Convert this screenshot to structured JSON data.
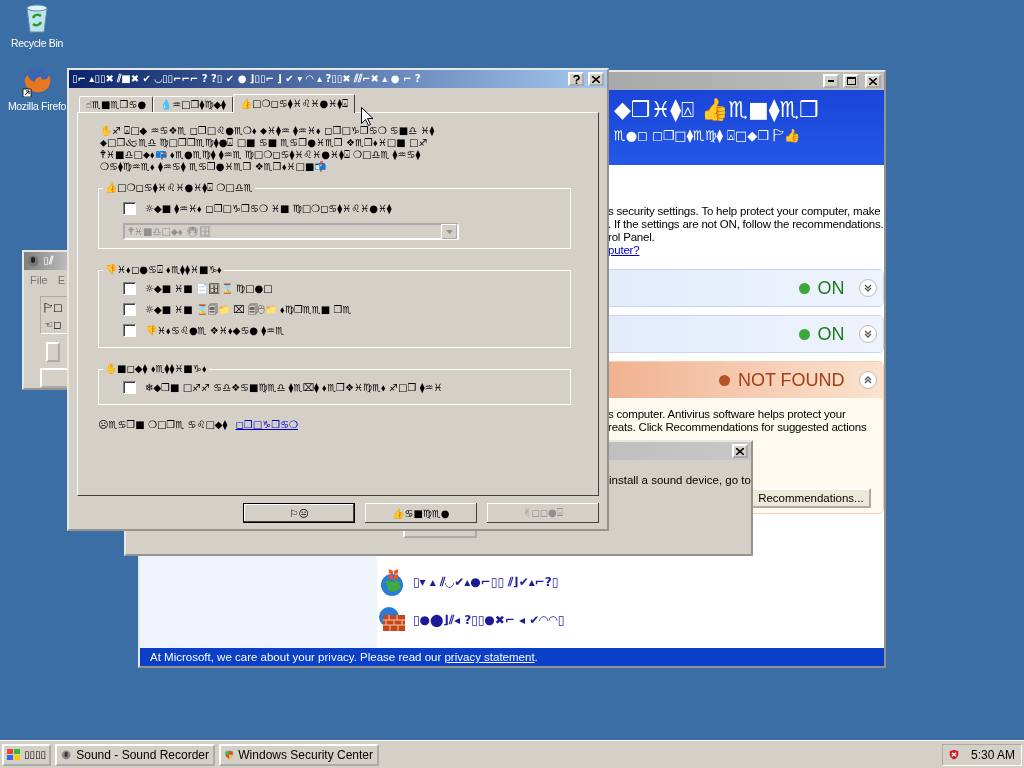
{
  "desktop_icons": [
    {
      "kind": "recycle",
      "label": "Recycle Bin"
    },
    {
      "kind": "browser",
      "label": "Mozilla Firefo"
    }
  ],
  "sound_recorder": {
    "title": "▯⫽",
    "menu": [
      "File",
      "E"
    ],
    "rows": [
      "🏱□",
      "☜◻"
    ]
  },
  "security_center": {
    "header_title": "◆❒♓⧫⍓ 👍♏■⧫♏❒",
    "header_subtitle": "♏●◻ ◻❒□⧫♏♍⧫ ⍓□◆❒ 🏱👍",
    "intro_lines": [
      "s security settings. To help protect your computer, make",
      ". If the settings are not ON, follow the recommendations.",
      "rol Panel."
    ],
    "intro_link": "puter?",
    "sections": [
      {
        "status": "ON",
        "color": "#3aa83a",
        "expanded": false
      },
      {
        "status": "ON",
        "color": "#3aa83a",
        "expanded": false
      },
      {
        "status": "NOT FOUND",
        "color": "#b5542c",
        "expanded": true,
        "body_lines": [
          "s computer. Antivirus software helps protect your",
          "reats. Click Recommendations for suggested actions"
        ],
        "button": "Recommendations..."
      }
    ],
    "links": [
      {
        "kind": "globe",
        "label": "▯▾ ▴ ⫽◡✔▴●⌐▯▯ ⫽⌋✔▴⌐?▯"
      },
      {
        "kind": "firewall",
        "label": "▯●⬤⌋⫽◂ ?▯▯●✖⌐ ◂ ✔◠◠▯"
      }
    ],
    "footer": {
      "text": "At Microsoft, we care about your privacy.  Please read our ",
      "link": "privacy statement",
      "after": "."
    }
  },
  "message_box": {
    "text": "install a sound device, go to"
  },
  "dialog": {
    "title": "▯⌐ ▴▯▯✖ ⫽■✖ ✔ ◡▯▯⌐⌐⌐ ? ?▯ ✔ ● ⌋▯▯⌐ ⌋ ✔ ▾ ◠ ▴ ?▯▯✖ ⫽⫽⌐✖ ▴ ● ⌐ ?",
    "tabs": [
      {
        "label": "☝♏■♏❒♋●",
        "selected": false
      },
      {
        "label": "💧♒□❒⧫♍◆⧫",
        "selected": false
      },
      {
        "label": "👍□❍◻♋⧫♓♌♓●♓⧫⍓",
        "selected": true
      }
    ],
    "intro_lines": [
      "✋♐ ⍓□◆ ♒♋❖♏ ◻❒□♌●♏❍⬧ ⬥♓⧫♒ ⧫♒♓⬧ ◻❒□♑❒♋❍ ♋■♎ ♓⧫",
      "⬥□❒🙵♏♎ ♍□❒❒♏♍⧫●⍓ □■ ♋■ ♏♋❒●♓♏❒ ❖♏❒⬧♓□■ □♐",
      "🕈♓■♎□⬥⬧📪 ⬧♏●♏♍⧫ ⧫♒♏ ♍□❍◻♋⧫♓♌♓●♓⧫⍓ ❍□♎♏ ⧫♒♋⧫",
      "❍♋⧫♍♒♏⬧ ⧫♒♋⧫ ♏♋❒●♓♏❒ ❖♏❒⬧♓□■📬"
    ],
    "groups": [
      {
        "title": "👍□❍◻♋⧫♓♌♓●♓⧫⍓ ❍□♎♏",
        "options": [
          {
            "label": "☼◆■ ⧫♒♓⬧ ◻❒□♑❒♋❍ ♓■ ♍□❍◻♋⧫♓♌♓●♓⧫",
            "checked": false
          }
        ],
        "select": {
          "value": "🕈♓■♎□⬥⬧ 🖲🗄",
          "disabled": true
        }
      },
      {
        "title": "👎♓⬧◻●♋⍓ ⬧♏⧫⧫♓■♑⬧",
        "options": [
          {
            "label": "☼◆■ ♓■ 📄🗄⌛ ♍□●□",
            "checked": false
          },
          {
            "label": "☼◆■ ♓■ ⌛🗐📁 ⌧ 🗐🖰📁 ⬧♍❒♏♏■ ❒♏",
            "checked": false
          },
          {
            "label": "👎♓⬧♋♌●♏ ❖♓⬧◆♋● ⧫♒♏",
            "checked": false
          }
        ]
      },
      {
        "title": "✋■◻◆⧫ ⬧♏⧫⧫♓■♑⬧",
        "options": [
          {
            "label": "❄◆❒■ □♐♐ ♋♎❖♋■♍♏♎ ⧫♏⌧⧫ ⬧♏❒❖♓♍♏⬧ ♐□❒ ⧫♒♓",
            "checked": false
          }
        ]
      }
    ],
    "learn_more": {
      "text": "☹♏♋❒■ ❍□❒♏ ♋♌□◆⧫",
      "link": "◻❒□♑❒♋❍"
    },
    "buttons": [
      {
        "label": "⚐😐",
        "disabled": false
      },
      {
        "label": "👍♋■♍♏●",
        "disabled": false
      },
      {
        "label": "✌◻◻●⍓",
        "disabled": true
      }
    ]
  },
  "taskbar": {
    "start": "▯▯▯▯",
    "tasks": [
      {
        "kind": "sound",
        "label": "Sound - Sound Recorder",
        "selected": false
      },
      {
        "kind": "shield",
        "label": "Windows Security Center",
        "selected": false
      }
    ],
    "clock": "5:30 AM"
  }
}
